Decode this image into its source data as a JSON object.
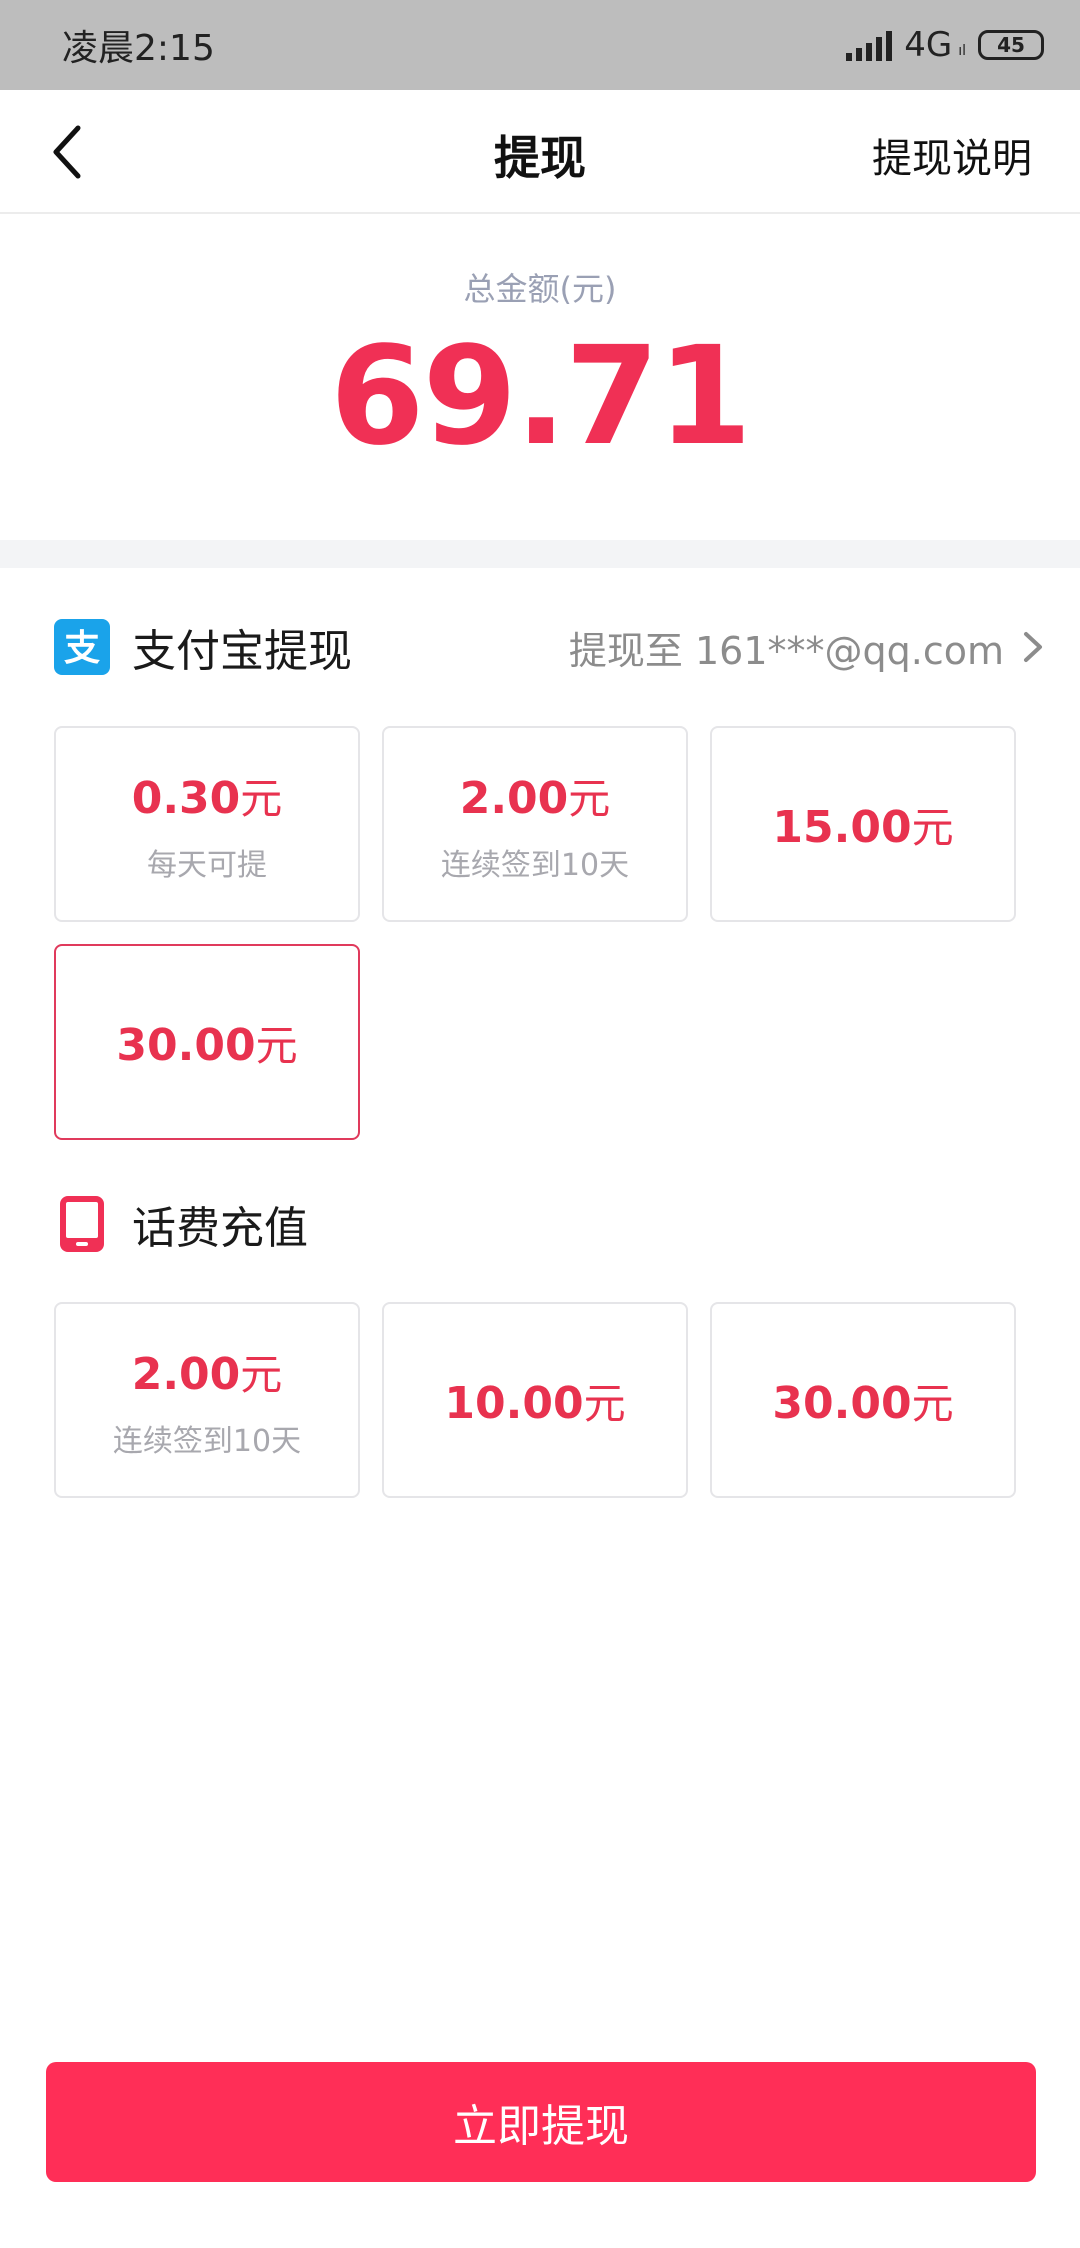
{
  "status_bar": {
    "time": "凌晨2:15",
    "network": "4G",
    "network_sub": "ıl",
    "battery": "45"
  },
  "header": {
    "title": "提现",
    "right_link": "提现说明",
    "back_icon": "chevron-left-icon"
  },
  "total": {
    "label": "总金额(元)",
    "amount": "69.71"
  },
  "alipay": {
    "icon": "alipay-icon",
    "title": "支付宝提现",
    "target": "提现至 161***@qq.com",
    "options": [
      {
        "amount": "0.30",
        "unit": "元",
        "note": "每天可提",
        "selected": false
      },
      {
        "amount": "2.00",
        "unit": "元",
        "note": "连续签到10天",
        "selected": false
      },
      {
        "amount": "15.00",
        "unit": "元",
        "note": "",
        "selected": false
      },
      {
        "amount": "30.00",
        "unit": "元",
        "note": "",
        "selected": true
      }
    ]
  },
  "phone": {
    "icon": "phone-icon",
    "title": "话费充值",
    "options": [
      {
        "amount": "2.00",
        "unit": "元",
        "note": "连续签到10天"
      },
      {
        "amount": "10.00",
        "unit": "元",
        "note": ""
      },
      {
        "amount": "30.00",
        "unit": "元",
        "note": ""
      }
    ]
  },
  "submit": {
    "label": "立即提现"
  },
  "colors": {
    "accent": "#ff2e57",
    "amount_text": "#e8324f",
    "alipay_blue": "#1aa3ea"
  }
}
